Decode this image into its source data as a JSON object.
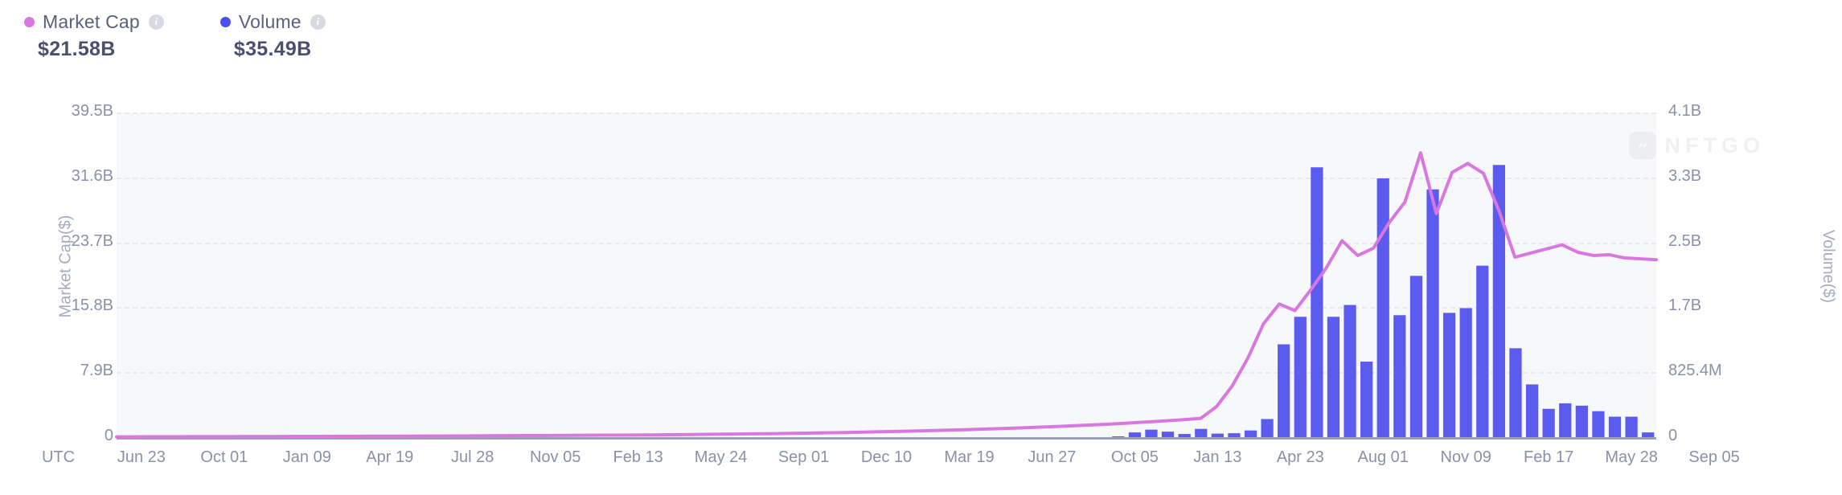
{
  "legend": {
    "market_cap": {
      "label": "Market Cap",
      "value": "$21.58B",
      "color": "#d977e0",
      "dot": "market-cap-dot",
      "info": "i"
    },
    "volume": {
      "label": "Volume",
      "value": "$35.49B",
      "color": "#4b4ef0",
      "dot": "volume-dot",
      "info": "i"
    }
  },
  "watermark": {
    "text": "NFTGO"
  },
  "chart_data": {
    "type": "bar",
    "title": "",
    "xlabel": "",
    "ylabel": "Market Cap($)",
    "y2label": "Volume($)",
    "grid": true,
    "legend_position": "top-left",
    "timezone_label": "UTC",
    "yticks_left": [
      "0",
      "7.9B",
      "15.8B",
      "23.7B",
      "31.6B",
      "39.5B"
    ],
    "yticks_left_values": [
      0,
      7900000000,
      15800000000,
      23700000000,
      31600000000,
      39500000000
    ],
    "ylim": [
      0,
      39500000000
    ],
    "yticks_right": [
      "0",
      "825.4M",
      "1.7B",
      "2.5B",
      "3.3B",
      "4.1B"
    ],
    "yticks_right_values": [
      0,
      825400000,
      1700000000,
      2500000000,
      3300000000,
      4100000000
    ],
    "y2lim": [
      0,
      4127000000
    ],
    "categories": [
      "Jun 23",
      "Oct 01",
      "Jan 09",
      "Apr 19",
      "Jul 28",
      "Nov 05",
      "Feb 13",
      "May 24",
      "Sep 01",
      "Dec 10",
      "Mar 19",
      "Jun 27",
      "Oct 05",
      "Jan 13",
      "Apr 23",
      "Aug 01",
      "Nov 09",
      "Feb 17",
      "May 28",
      "Sep 05"
    ],
    "series": [
      {
        "name": "Volume",
        "type": "bar",
        "axis": "right",
        "color": "#5b5bf0",
        "unit": "USD",
        "values": [
          0,
          0,
          0,
          0,
          0,
          0,
          0,
          0,
          0,
          0,
          0,
          0,
          0,
          0,
          0,
          0,
          0,
          0,
          0,
          0,
          0,
          0,
          0,
          0,
          0,
          0,
          0,
          0,
          0,
          0,
          0,
          0,
          0,
          0,
          0,
          0,
          0,
          0,
          0,
          0,
          0,
          0,
          0,
          0,
          0,
          0,
          0,
          0,
          0,
          0,
          0,
          0,
          0,
          0,
          0,
          0,
          0,
          0,
          0,
          0,
          10000000,
          60000000,
          95000000,
          70000000,
          40000000,
          105000000,
          45000000,
          50000000,
          85000000,
          230000000,
          1180000000,
          1530000000,
          3430000000,
          1530000000,
          1680000000,
          960000000,
          3290000000,
          1550000000,
          2050000000,
          3150000000,
          1580000000,
          1640000000,
          2180000000,
          3460000000,
          1130000000,
          670000000,
          360000000,
          430000000,
          400000000,
          330000000,
          260000000,
          260000000,
          60000000
        ]
      },
      {
        "name": "Market Cap",
        "type": "line",
        "axis": "left",
        "color": "#d977e0",
        "unit": "USD",
        "values": [
          40000000,
          40000000,
          45000000,
          50000000,
          55000000,
          60000000,
          60000000,
          65000000,
          70000000,
          70000000,
          75000000,
          80000000,
          85000000,
          90000000,
          95000000,
          100000000,
          105000000,
          110000000,
          115000000,
          120000000,
          130000000,
          140000000,
          150000000,
          160000000,
          170000000,
          180000000,
          190000000,
          200000000,
          210000000,
          220000000,
          230000000,
          240000000,
          250000000,
          260000000,
          270000000,
          290000000,
          310000000,
          330000000,
          350000000,
          370000000,
          390000000,
          410000000,
          430000000,
          460000000,
          490000000,
          520000000,
          550000000,
          590000000,
          630000000,
          670000000,
          710000000,
          760000000,
          810000000,
          860000000,
          910000000,
          970000000,
          1030000000,
          1090000000,
          1160000000,
          1230000000,
          1310000000,
          1390000000,
          1480000000,
          1570000000,
          1670000000,
          1780000000,
          1890000000,
          2010000000,
          2140000000,
          2280000000,
          3700000000,
          6200000000,
          9600000000,
          13800000000,
          16200000000,
          15400000000,
          17900000000,
          20600000000,
          23900000000,
          22100000000,
          23000000000,
          26100000000,
          28600000000,
          34600000000,
          27200000000,
          32200000000,
          33300000000,
          32100000000,
          27500000000,
          21900000000,
          22400000000,
          22900000000,
          23400000000,
          22500000000,
          22100000000,
          22200000000,
          21800000000,
          21700000000,
          21580000000
        ]
      }
    ]
  }
}
